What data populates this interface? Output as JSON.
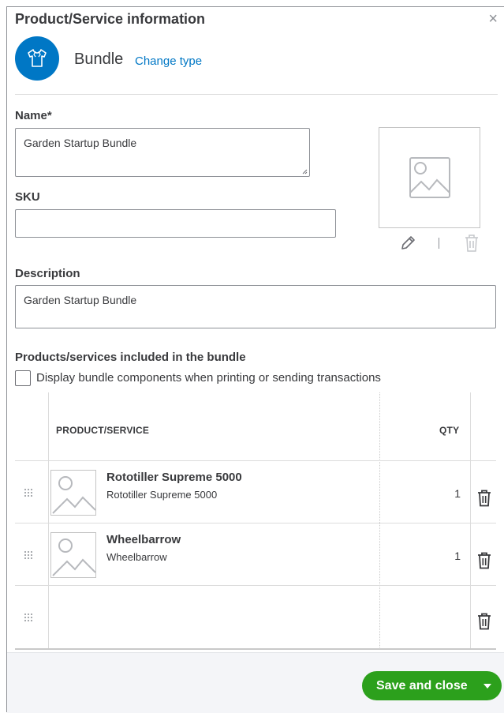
{
  "dialog": {
    "title": "Product/Service information",
    "close_glyph": "×"
  },
  "item_type": {
    "name": "Bundle",
    "change_link": "Change type",
    "icon": "shirt-icon",
    "accent": "#0077c5"
  },
  "fields": {
    "name_label": "Name*",
    "name_value": "Garden Startup Bundle",
    "sku_label": "SKU",
    "sku_value": "",
    "description_label": "Description",
    "description_value": "Garden Startup Bundle"
  },
  "image": {
    "placeholder_icon": "image-placeholder-icon",
    "edit_icon": "pencil-icon",
    "delete_icon": "trash-icon"
  },
  "bundle": {
    "section_label": "Products/services included in the bundle",
    "display_components_label": "Display bundle components when printing or sending transactions",
    "display_components_checked": false,
    "columns": [
      "PRODUCT/SERVICE",
      "QTY"
    ],
    "rows": [
      {
        "name": "Rototiller Supreme 5000",
        "description": "Rototiller Supreme 5000",
        "qty": "1"
      },
      {
        "name": "Wheelbarrow",
        "description": "Wheelbarrow",
        "qty": "1"
      },
      {
        "name": "",
        "description": "",
        "qty": ""
      }
    ]
  },
  "footer": {
    "save_label": "Save and close",
    "save_color": "#2ca01c"
  }
}
